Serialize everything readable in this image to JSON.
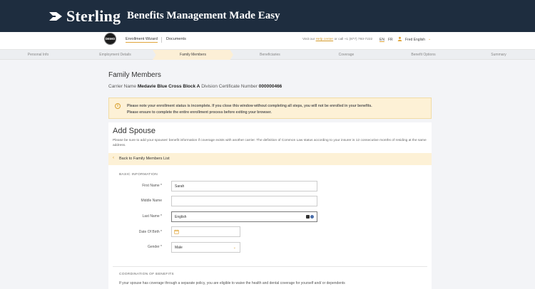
{
  "brand": {
    "logo_text": "Sterling",
    "tagline": "Benefits Management Made Easy"
  },
  "subnav": {
    "demo_badge": "DEMO",
    "tabs": [
      "Enrollment Wizard",
      "Documents"
    ],
    "help_prefix": "Visit our",
    "help_link": "Help center",
    "help_suffix": "or call +1 (877) 793-7222",
    "languages": [
      "EN",
      "FR"
    ],
    "user_name": "Fred English"
  },
  "steps": [
    "Personal Info",
    "Employment Details",
    "Family Members",
    "Beneficiaries",
    "Coverage",
    "Benefit Options",
    "Summary"
  ],
  "page": {
    "title": "Family Members",
    "carrier_label": "Carrier Name",
    "carrier_value": "Medavie Blue Cross Block A",
    "division_label": "Division",
    "certificate_label": "Certificate Number",
    "certificate_value": "000000466"
  },
  "alert": {
    "line1": "Please note your enrollment status is incomplete. If you close this window without completing all steps, you will not be enrolled in your benefits.",
    "line2": "Please ensure to complete the entire enrollment process before exiting your browser."
  },
  "form": {
    "heading": "Add Spouse",
    "intro": "Please be sure to add your spouses' benefit information if coverage exists with another carrier. The definition of Common Law status according to your insurer is 12 consecutive months of residing at the same address.",
    "back_label": "Back to Family Members List",
    "basic_info_label": "BASIC INFORMATION",
    "fields": {
      "first_name_label": "First Name *",
      "first_name_value": "Sarah",
      "middle_name_label": "Middle Name",
      "middle_name_value": "",
      "last_name_label": "Last Name *",
      "last_name_value": "English",
      "dob_label": "Date Of Birth *",
      "dob_value": "",
      "gender_label": "Gender *",
      "gender_value": "Male"
    },
    "cob_label": "COORDINATION OF BENEFITS",
    "cob_text": "If your spouse has coverage through a separate policy, you are eligible to waive the health and dental coverage for yourself and/ or dependents"
  }
}
